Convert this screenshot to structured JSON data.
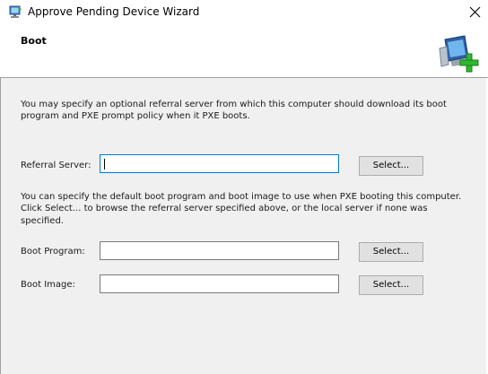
{
  "window": {
    "title": "Approve Pending Device Wizard",
    "title_icon": "wizard-computer-icon",
    "close_icon": "close-icon"
  },
  "header": {
    "title": "Boot",
    "icon": "computer-add-icon"
  },
  "content": {
    "description_referral": "You may specify an optional referral server from which this computer should download its boot program and PXE prompt policy when it PXE boots.",
    "description_boot": "You can specify the default boot program and boot image to use when PXE booting this computer. Click Select... to browse the referral server specified above, or the local server if none was specified.",
    "fields": {
      "referral_server": {
        "label": "Referral Server:",
        "value": "",
        "button": "Select..."
      },
      "boot_program": {
        "label": "Boot Program:",
        "value": "",
        "button": "Select..."
      },
      "boot_image": {
        "label": "Boot Image:",
        "value": "",
        "button": "Select..."
      }
    }
  },
  "colors": {
    "focus_border": "#0078d7",
    "content_bg": "#f0f0f0",
    "plus_green": "#2fb82f"
  }
}
